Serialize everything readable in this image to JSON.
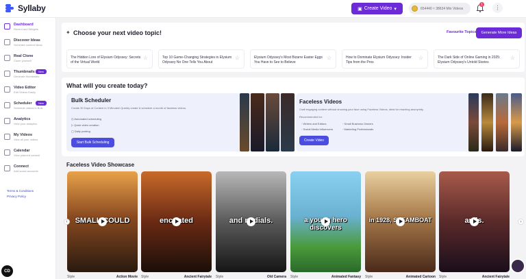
{
  "app": {
    "name": "Syllaby"
  },
  "header": {
    "create_label": "Create Video",
    "credits_text": "654440 ≈ 38634 Min Videos",
    "notification_count": "1"
  },
  "sidebar": {
    "items": [
      {
        "title": "Dashboard",
        "sub": "Recent and Widgets",
        "icon": "home-icon"
      },
      {
        "title": "Discover Ideas",
        "sub": "Generate content ideas",
        "icon": "search-icon"
      },
      {
        "title": "Real Clone",
        "sub": "Clone yourself",
        "icon": "user-icon"
      },
      {
        "title": "Thumbnails",
        "sub": "Generate thumbnails",
        "icon": "image-icon",
        "badge": "New"
      },
      {
        "title": "Video Editor",
        "sub": "Edit Videos Easily",
        "icon": "edit-icon"
      },
      {
        "title": "Scheduler",
        "sub": "Schedule videos in Bulk",
        "icon": "clock-icon",
        "badge": "New"
      },
      {
        "title": "Analytics",
        "sub": "View your analytics",
        "icon": "chart-icon"
      },
      {
        "title": "My Videos",
        "sub": "View all your videos",
        "icon": "video-icon"
      },
      {
        "title": "Calendar",
        "sub": "View planned content",
        "icon": "calendar-icon"
      },
      {
        "title": "Connect",
        "sub": "Add social accounts",
        "icon": "link-icon"
      }
    ],
    "terms": "Terms & Conditions",
    "privacy": "Privacy Policy",
    "bottom_button": "CD"
  },
  "topics": {
    "title": "Choose your next video topic!",
    "favourite_label": "Favourite Topics",
    "generate_label": "Generate More Ideas",
    "items": [
      "The Hidden Lore of Elysium Odyssey: Secrets of the Virtual World",
      "Top 10 Game-Changing Strategies in Elysium Odyssey No One Tells You About",
      "Elysium Odyssey's Most Bizarre Easter Eggs You Have to See to Believe",
      "How to Dominate Elysium Odyssey: Insider Tips from the Pros",
      "The Dark Side of Online Gaming in 2025: Elysium Odyssey's Untold Stories"
    ]
  },
  "create": {
    "title": "What will you create today?",
    "bulk": {
      "title": "Bulk Scheduler",
      "desc": "Create 30 Days of Content in 3 Minutes! Quickly create & schedule a month of faceless videos.",
      "features": [
        "Automated scheduling",
        "Quick video creation",
        "Daily posting"
      ],
      "button": "Start Bulk Scheduling"
    },
    "faceless": {
      "title": "Faceless Videos",
      "desc": "Craft engaging content without showing your face using Faceless Videos, ideal for reaching anonymity.",
      "recommended_label": "Recommended for:",
      "recommended": [
        "Writers and Editors",
        "Small Business Owners",
        "Social Media Influencers",
        "Marketing Professionals"
      ],
      "button": "Create Video"
    }
  },
  "showcase": {
    "title": "Faceless Video Showcase",
    "style_label": "Style",
    "items": [
      {
        "caption": "SMALL COULD",
        "style": "Action Movie",
        "colors": [
          "#d88a3a",
          "#3a2a1a"
        ]
      },
      {
        "caption": "enc  rated",
        "style": "Ancient Fairytale",
        "colors": [
          "#b84a1e",
          "#2a1a10"
        ]
      },
      {
        "caption": "and m   dials.",
        "style": "Old Camera",
        "colors": [
          "#9a9a9a",
          "#1a1a1a"
        ]
      },
      {
        "caption": "a young hero discovers",
        "style": "Animated Fantasy",
        "colors": [
          "#6ab8e0",
          "#3a8a3a"
        ]
      },
      {
        "caption": "in 1928, STEAMBOAT",
        "style": "Animated Cartoon",
        "colors": [
          "#d8b070",
          "#5a3020"
        ]
      },
      {
        "caption": "an  is.",
        "style": "Ancient Fairytale",
        "colors": [
          "#8a4a3a",
          "#2a1a2a"
        ]
      }
    ]
  }
}
